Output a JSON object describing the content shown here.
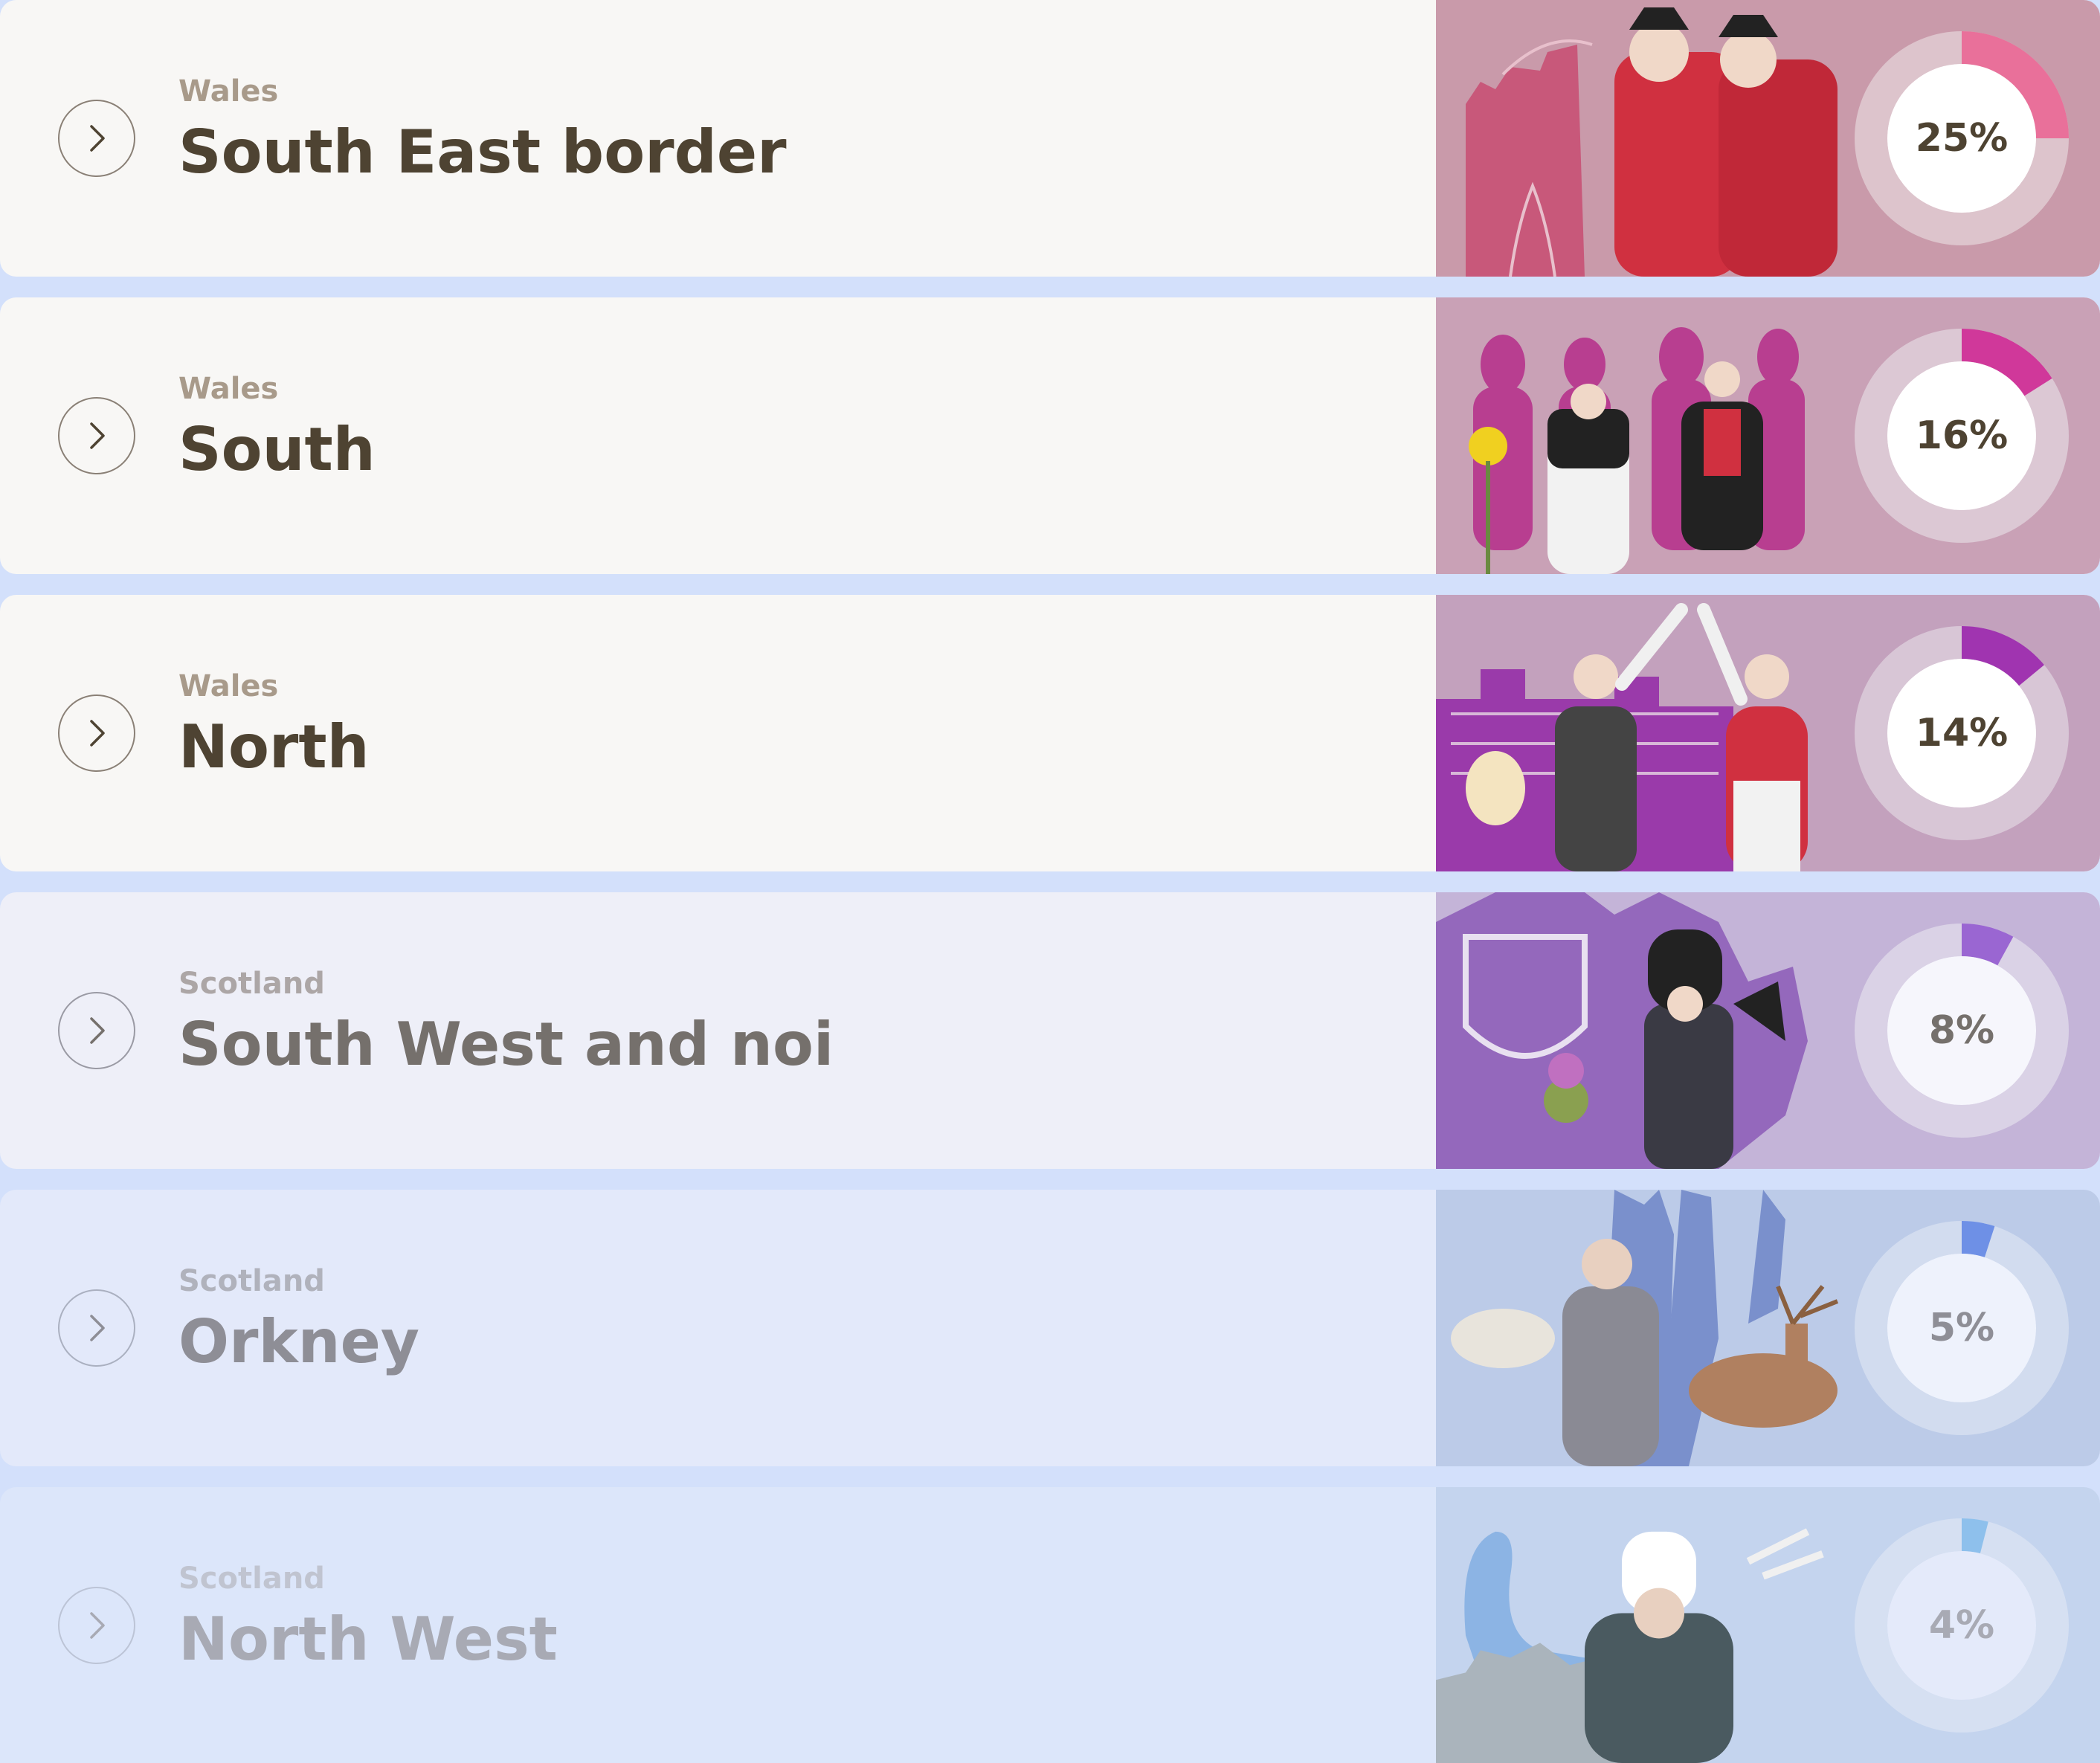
{
  "regions": [
    {
      "country": "Wales",
      "name": "South East border",
      "percent_label": "25%",
      "progress": 0.25,
      "accent": "#e9709a",
      "panel_bg": "#c99aaa",
      "silhouette": "#c8587a"
    },
    {
      "country": "Wales",
      "name": "South",
      "percent_label": "16%",
      "progress": 0.16,
      "accent": "#d0389a",
      "panel_bg": "#c9a1b6",
      "silhouette": "#b83e90"
    },
    {
      "country": "Wales",
      "name": "North",
      "percent_label": "14%",
      "progress": 0.14,
      "accent": "#a034b0",
      "panel_bg": "#c3a1bd",
      "silhouette": "#9a3aaa"
    },
    {
      "country": "Scotland",
      "name": "South West and noi",
      "percent_label": "8%",
      "progress": 0.08,
      "accent": "#9a66d2",
      "panel_bg": "#c4b4d8",
      "silhouette": "#9468bc"
    },
    {
      "country": "Scotland",
      "name": "Orkney",
      "percent_label": "5%",
      "progress": 0.05,
      "accent": "#6e90e6",
      "panel_bg": "#bccbe8",
      "silhouette": "#7a90cc"
    },
    {
      "country": "Scotland",
      "name": "North West",
      "percent_label": "4%",
      "progress": 0.04,
      "accent": "#8ec0ec",
      "panel_bg": "#c4d4ee",
      "silhouette": "#8cb4e4"
    }
  ]
}
